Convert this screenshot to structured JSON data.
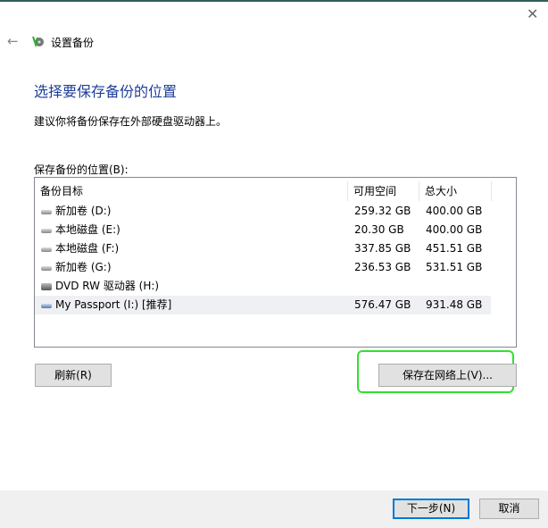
{
  "window": {
    "title": "设置备份"
  },
  "heading": "选择要保存备份的位置",
  "description": "建议你将备份保存在外部硬盘驱动器上。",
  "list_label": "保存备份的位置(B):",
  "columns": [
    "备份目标",
    "可用空间",
    "总大小"
  ],
  "rows": [
    {
      "name": "新加卷 (D:)",
      "free": "259.32 GB",
      "total": "400.00 GB",
      "icon": "hdd"
    },
    {
      "name": "本地磁盘 (E:)",
      "free": "20.30 GB",
      "total": "400.00 GB",
      "icon": "hdd"
    },
    {
      "name": "本地磁盘 (F:)",
      "free": "337.85 GB",
      "total": "451.51 GB",
      "icon": "hdd"
    },
    {
      "name": "新加卷 (G:)",
      "free": "236.53 GB",
      "total": "531.51 GB",
      "icon": "hdd"
    },
    {
      "name": "DVD RW 驱动器 (H:)",
      "free": "",
      "total": "",
      "icon": "dvd"
    },
    {
      "name": "My Passport (I:) [推荐]",
      "free": "576.47 GB",
      "total": "931.48 GB",
      "icon": "usb",
      "selected": true
    }
  ],
  "buttons": {
    "refresh": "刷新(R)",
    "save_network": "保存在网络上(V)...",
    "next": "下一步(N)",
    "cancel": "取消"
  },
  "icons": {
    "close": "✕",
    "back": "←"
  }
}
